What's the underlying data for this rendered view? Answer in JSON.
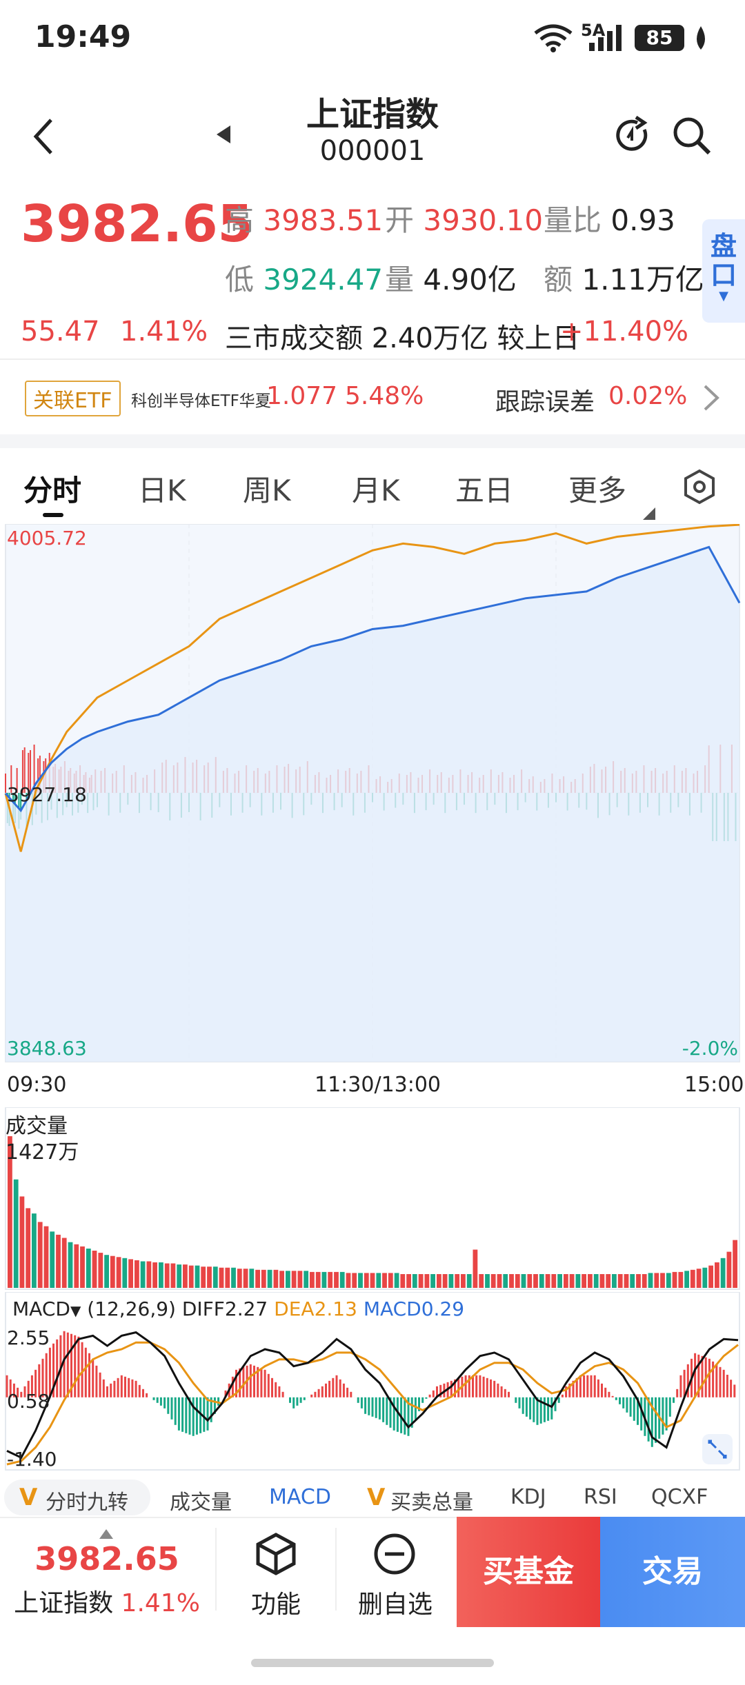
{
  "status_bar": {
    "time": "19:49",
    "network": "5A",
    "battery": "85"
  },
  "header": {
    "title": "上证指数",
    "code": "000001"
  },
  "quote": {
    "price": "3982.65",
    "change": "55.47",
    "change_pct": "1.41%",
    "high_label": "高",
    "high": "3983.51",
    "open_label": "开",
    "open": "3930.10",
    "vol_ratio_label": "量比",
    "vol_ratio": "0.93",
    "low_label": "低",
    "low": "3924.47",
    "volume_label": "量",
    "volume": "4.90亿",
    "amount_label": "额",
    "amount": "1.11万亿",
    "market_turnover": "三市成交额 2.40万亿 较上日",
    "market_turnover_change": "+11.40%",
    "panel_button": "盘口"
  },
  "etf": {
    "badge": "关联ETF",
    "name": "科创半导体ETF华夏",
    "price": "1.077",
    "pct": "5.48%",
    "tracking_label": "跟踪误差",
    "tracking_value": "0.02%"
  },
  "tabs": [
    {
      "label": "分时",
      "active": true
    },
    {
      "label": "日K"
    },
    {
      "label": "周K"
    },
    {
      "label": "月K"
    },
    {
      "label": "五日"
    },
    {
      "label": "更多"
    }
  ],
  "colors": {
    "up": "#e84545",
    "down": "#18a887",
    "price_line": "#2f6fd8",
    "avg_line": "#e89414",
    "buy_button": "#ef4a4a",
    "trade_button": "#4d8ff0"
  },
  "chart_data": [
    {
      "type": "line",
      "title": "",
      "y_top_label": "4005.72",
      "y_mid_label": "3927.18",
      "y_bottom_label": "3848.63",
      "pct_bottom_label": "-2.0%",
      "ylim": [
        3848.63,
        4005.72
      ],
      "x_ticks": [
        "09:30",
        "11:30/13:00",
        "15:00"
      ],
      "series": [
        {
          "x": [
            0,
            5,
            10,
            15,
            20,
            25,
            30,
            40,
            50,
            60,
            70,
            80,
            90,
            100,
            110,
            120,
            130,
            140,
            150,
            160,
            170,
            180,
            190,
            200,
            210,
            220,
            230,
            240
          ],
          "values": [
            3927,
            3922,
            3930,
            3936,
            3940,
            3943,
            3945,
            3948,
            3950,
            3955,
            3960,
            3963,
            3966,
            3970,
            3972,
            3975,
            3976,
            3978,
            3980,
            3982,
            3984,
            3985,
            3986,
            3990,
            3993,
            3996,
            3999,
            3982.65
          ]
        },
        {
          "x": [
            0,
            5,
            10,
            15,
            20,
            25,
            30,
            40,
            50,
            60,
            70,
            80,
            90,
            100,
            110,
            120,
            130,
            140,
            150,
            160,
            170,
            180,
            190,
            200,
            210,
            220,
            230,
            240
          ],
          "values": [
            3927,
            3910,
            3928,
            3937,
            3945,
            3950,
            3955,
            3960,
            3965,
            3970,
            3978,
            3982,
            3986,
            3990,
            3994,
            3998,
            4000,
            3999,
            3997,
            4000,
            4001,
            4003,
            4000,
            4002,
            4003,
            4004,
            4005,
            4005.5
          ]
        }
      ]
    },
    {
      "type": "bar",
      "title": "成交量",
      "max_label": "1427万",
      "values": [
        14.27,
        10.2,
        8.6,
        7.5,
        7.0,
        6.2,
        5.8,
        5.3,
        5.0,
        4.7,
        4.3,
        4.1,
        3.9,
        3.7,
        3.5,
        3.3,
        3.1,
        3.0,
        2.9,
        2.8,
        2.7,
        2.6,
        2.5,
        2.5,
        2.4,
        2.4,
        2.3,
        2.3,
        2.2,
        2.2,
        2.1,
        2.1,
        2.0,
        2.0,
        2.0,
        1.9,
        1.9,
        1.9,
        1.8,
        1.8,
        1.8,
        1.7,
        1.7,
        1.7,
        1.7,
        1.6,
        1.6,
        1.6,
        1.6,
        1.6,
        1.5,
        1.5,
        1.5,
        1.5,
        1.5,
        1.5,
        1.4,
        1.4,
        1.4,
        1.4,
        1.4,
        1.4,
        1.4,
        1.4,
        1.4,
        1.3,
        1.3,
        1.3,
        1.3,
        1.3,
        1.3,
        1.3,
        1.3,
        1.3,
        1.3,
        1.3,
        1.3,
        3.6,
        1.3,
        1.3,
        1.3,
        1.3,
        1.3,
        1.3,
        1.3,
        1.3,
        1.3,
        1.3,
        1.3,
        1.3,
        1.3,
        1.3,
        1.3,
        1.3,
        1.3,
        1.3,
        1.3,
        1.3,
        1.3,
        1.3,
        1.3,
        1.3,
        1.3,
        1.3,
        1.3,
        1.3,
        1.4,
        1.4,
        1.4,
        1.4,
        1.5,
        1.5,
        1.6,
        1.7,
        1.8,
        1.9,
        2.1,
        2.4,
        2.8,
        3.4,
        4.5
      ]
    },
    {
      "type": "line",
      "title": "MACD",
      "params": "(12,26,9)",
      "diff": "DIFF2.27",
      "dea": "DEA2.13",
      "macd": "MACD0.29",
      "y_labels": [
        "2.55",
        "0.58",
        "-1.40"
      ],
      "ylim": [
        -1.4,
        2.55
      ],
      "series": [
        {
          "values": [
            -1.0,
            -1.2,
            -0.4,
            0.6,
            1.7,
            2.3,
            2.4,
            2.1,
            2.4,
            2.5,
            2.2,
            1.8,
            1.0,
            0.3,
            -0.1,
            0.4,
            1.2,
            1.8,
            2.0,
            1.9,
            1.5,
            1.6,
            1.9,
            2.3,
            2.0,
            1.4,
            1.0,
            0.3,
            -0.3,
            0.1,
            0.6,
            0.9,
            1.4,
            1.8,
            1.9,
            1.7,
            1.1,
            0.5,
            0.3,
            1.0,
            1.6,
            1.9,
            1.7,
            1.2,
            0.5,
            -0.6,
            -0.9,
            0.3,
            1.4,
            2.0,
            2.3,
            2.27
          ]
        },
        {
          "values": [
            -1.4,
            -1.3,
            -0.9,
            -0.3,
            0.5,
            1.2,
            1.7,
            1.9,
            2.0,
            2.2,
            2.2,
            2.0,
            1.6,
            1.0,
            0.5,
            0.4,
            0.7,
            1.2,
            1.5,
            1.7,
            1.7,
            1.6,
            1.7,
            1.9,
            1.9,
            1.7,
            1.4,
            0.9,
            0.4,
            0.2,
            0.4,
            0.6,
            1.0,
            1.4,
            1.6,
            1.6,
            1.4,
            1.0,
            0.7,
            0.8,
            1.2,
            1.5,
            1.6,
            1.4,
            1.0,
            0.3,
            -0.3,
            -0.1,
            0.6,
            1.3,
            1.8,
            2.13
          ]
        }
      ]
    }
  ],
  "indicator_tabs": [
    "分时九转",
    "成交量",
    "MACD",
    "买卖总量",
    "KDJ",
    "RSI",
    "QCXF"
  ],
  "bottom_bar": {
    "price": "3982.65",
    "name": "上证指数",
    "pct": "1.41%",
    "func_label": "功能",
    "remove_label": "删自选",
    "buy_fund_label": "买基金",
    "trade_label": "交易"
  }
}
